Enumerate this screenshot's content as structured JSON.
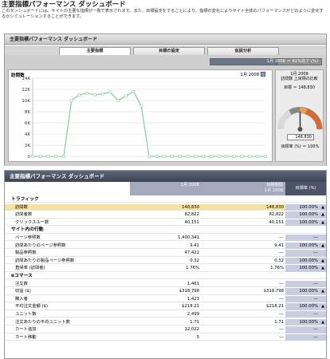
{
  "header": {
    "title": "主要指標パフォーマンス ダッシュボード",
    "description": "このダッシュボードには、サイトの主要な指標が一覧で表示されます。また、目標設定をすることにより、指標の変化によりサイト全体のパフォーマンスがどのように変化するかシミュレーションすることができます。"
  },
  "panel": {
    "title": "主要指標パフォーマンス ダッシュボード",
    "tabs": [
      "主要指標",
      "目標の設定",
      "仮説分析"
    ],
    "active_tab": 0,
    "progress": {
      "label": "1月 2008 ＝ 61%完了 (%)",
      "fraction": 0.61
    }
  },
  "visits_chart": {
    "title": "訪問数",
    "legend": "1月 2008"
  },
  "gauge": {
    "heading": "1月 2008",
    "subheading": "訪問数 上目標の比較",
    "target_label": "目標 ＝ 148,830",
    "reading": "148,830",
    "rate_label": "目標率 (%) ＝ 100%"
  },
  "chart_data": {
    "type": "line",
    "title": "訪問数",
    "x": [
      1,
      2,
      3,
      4,
      5,
      6,
      7,
      8,
      9,
      10,
      11,
      12,
      13,
      14,
      15,
      16,
      17,
      18,
      19,
      20,
      21,
      22,
      23,
      24,
      25,
      26,
      27,
      28,
      29,
      30,
      31
    ],
    "series": [
      {
        "name": "1月 2008",
        "values": [
          0,
          0,
          0,
          0,
          0,
          10000,
          11000,
          11300,
          11000,
          11200,
          11500,
          10000,
          10800,
          11600,
          9000,
          0,
          0,
          0,
          0,
          0,
          0,
          0,
          0,
          0,
          0,
          0,
          0,
          0,
          0,
          0,
          0
        ]
      }
    ],
    "yticks": [
      "0",
      "2K",
      "4K",
      "6K",
      "8K",
      "10K",
      "12K",
      "14K"
    ],
    "ylim": [
      0,
      14000
    ],
    "grid": true
  },
  "metrics": {
    "title": "主要指標パフォーマンス ダッシュボード",
    "col1": "1月 2008",
    "col2": "目標期間\n1月 2008",
    "col3": "目標率 (%)",
    "rows": [
      {
        "type": "cat",
        "label": "トラフィック"
      },
      {
        "type": "row",
        "label": "訪問数",
        "v1": "148,830",
        "v2": "148,830",
        "v3": "100.00%",
        "up": true,
        "hl": true
      },
      {
        "type": "row",
        "label": "訪問者数",
        "v1": "82,822",
        "v2": "82,822",
        "v3": "100.00%",
        "up": true
      },
      {
        "type": "row",
        "label": "クリックスルー数",
        "v1": "40,151",
        "v2": "40,151",
        "v3": "100.00%",
        "up": true
      },
      {
        "type": "cat",
        "label": "サイト内の行動"
      },
      {
        "type": "row",
        "label": "ページ参照数",
        "v1": "1,400,341",
        "v2": "---",
        "v3": "---"
      },
      {
        "type": "row",
        "label": "訪問あたりのページ参照数",
        "v1": "9.41",
        "v2": "9.41",
        "v3": "100.00%",
        "up": true
      },
      {
        "type": "row",
        "label": "製品参照数",
        "v1": "47,422",
        "v2": "---",
        "v3": "---"
      },
      {
        "type": "row",
        "label": "訪問あたりの製品ページ参照数",
        "v1": "0.32",
        "v2": "0.32",
        "v3": "100.00%",
        "up": true
      },
      {
        "type": "row",
        "label": "直帰率 (訪問者)",
        "v1": "1.76%",
        "v2": "1.76%",
        "v3": "100.00%",
        "up": true
      },
      {
        "type": "cat",
        "label": "eコマース"
      },
      {
        "type": "row",
        "label": "注文数",
        "v1": "1,461",
        "v2": "---",
        "v3": "---"
      },
      {
        "type": "row",
        "label": "収益 ($)",
        "v1": "$318,798",
        "v2": "$318,798",
        "v3": "100.00%",
        "up": true
      },
      {
        "type": "row",
        "label": "購入者",
        "v1": "1,423",
        "v2": "---",
        "v3": "---"
      },
      {
        "type": "row",
        "label": "平均注文金額 ($)",
        "v1": "$218.21",
        "v2": "$218.21",
        "v3": "100.00%",
        "up": true
      },
      {
        "type": "row",
        "label": "ユニット数",
        "v1": "2,499",
        "v2": "---",
        "v3": "---"
      },
      {
        "type": "row",
        "label": "注文あたりの平均ユニット数",
        "v1": "1.71",
        "v2": "1.71",
        "v3": "100.00%",
        "up": true
      },
      {
        "type": "row",
        "label": "カート追加",
        "v1": "12,022",
        "v2": "---",
        "v3": "---"
      },
      {
        "type": "row",
        "label": "カート移動",
        "v1": "5",
        "v2": "---",
        "v3": "---"
      }
    ]
  },
  "colors": {
    "accent": "#4c5566",
    "highlight": "#f3e2a3",
    "line": "#8fd0a6"
  }
}
